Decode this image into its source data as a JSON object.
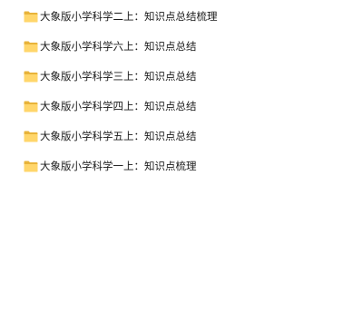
{
  "files": [
    {
      "name": "大象版小学科学二上：知识点总结梳理",
      "icon": "folder-icon"
    },
    {
      "name": "大象版小学科学六上：知识点总结",
      "icon": "folder-icon"
    },
    {
      "name": "大象版小学科学三上：知识点总结",
      "icon": "folder-icon"
    },
    {
      "name": "大象版小学科学四上：知识点总结",
      "icon": "folder-icon"
    },
    {
      "name": "大象版小学科学五上：知识点总结",
      "icon": "folder-icon"
    },
    {
      "name": "大象版小学科学一上：知识点梳理",
      "icon": "folder-icon"
    }
  ],
  "colors": {
    "folder_back": "#E8B33A",
    "folder_front": "#FFD66B",
    "text": "#1A1A1A"
  }
}
